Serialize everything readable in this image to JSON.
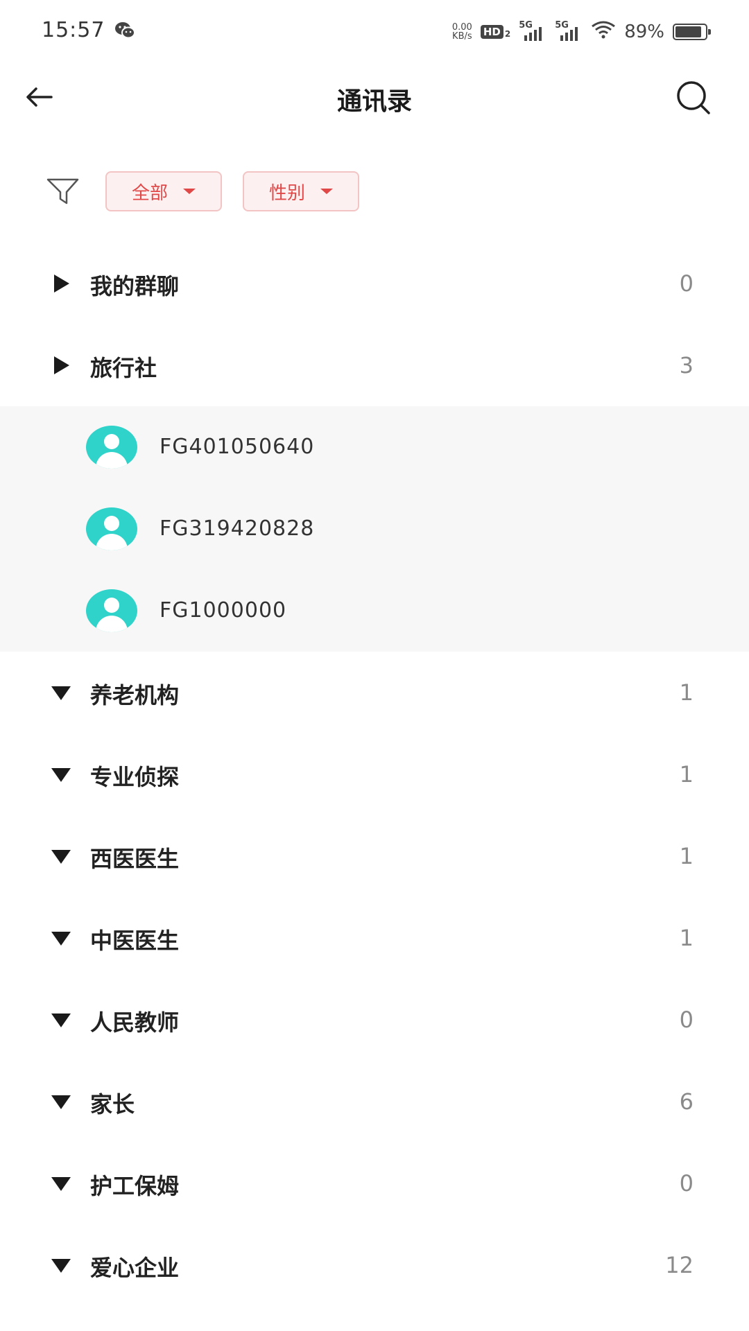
{
  "status_bar": {
    "time": "15:57",
    "net_speed_value": "0.00",
    "net_speed_unit": "KB/s",
    "hd_label": "HD",
    "hd_sub": "2",
    "signal_1_label": "5G",
    "signal_2_label": "5G",
    "battery": "89%",
    "battery_level": 0.89
  },
  "header": {
    "title": "通讯录",
    "back_icon": "arrow-left-icon",
    "search_icon": "search-icon"
  },
  "filters": {
    "filter_icon": "funnel-icon",
    "chips": [
      {
        "label": "全部"
      },
      {
        "label": "性别"
      }
    ]
  },
  "colors": {
    "accent": "#e04848",
    "chip_bg": "#fdf0f0",
    "avatar": "#2fd3c9",
    "count": "#8a8a8a"
  },
  "groups": [
    {
      "name": "我的群聊",
      "count": "0",
      "expanded": false
    },
    {
      "name": "旅行社",
      "count": "3",
      "expanded": true,
      "members": [
        "FG401050640",
        "FG319420828",
        "FG1000000"
      ]
    },
    {
      "name": "养老机构",
      "count": "1",
      "expanded": true
    },
    {
      "name": "专业侦探",
      "count": "1",
      "expanded": true
    },
    {
      "name": "西医医生",
      "count": "1",
      "expanded": true
    },
    {
      "name": "中医医生",
      "count": "1",
      "expanded": true
    },
    {
      "name": "人民教师",
      "count": "0",
      "expanded": true
    },
    {
      "name": "家长",
      "count": "6",
      "expanded": true
    },
    {
      "name": "护工保姆",
      "count": "0",
      "expanded": true
    },
    {
      "name": "爱心企业",
      "count": "12",
      "expanded": true
    }
  ]
}
